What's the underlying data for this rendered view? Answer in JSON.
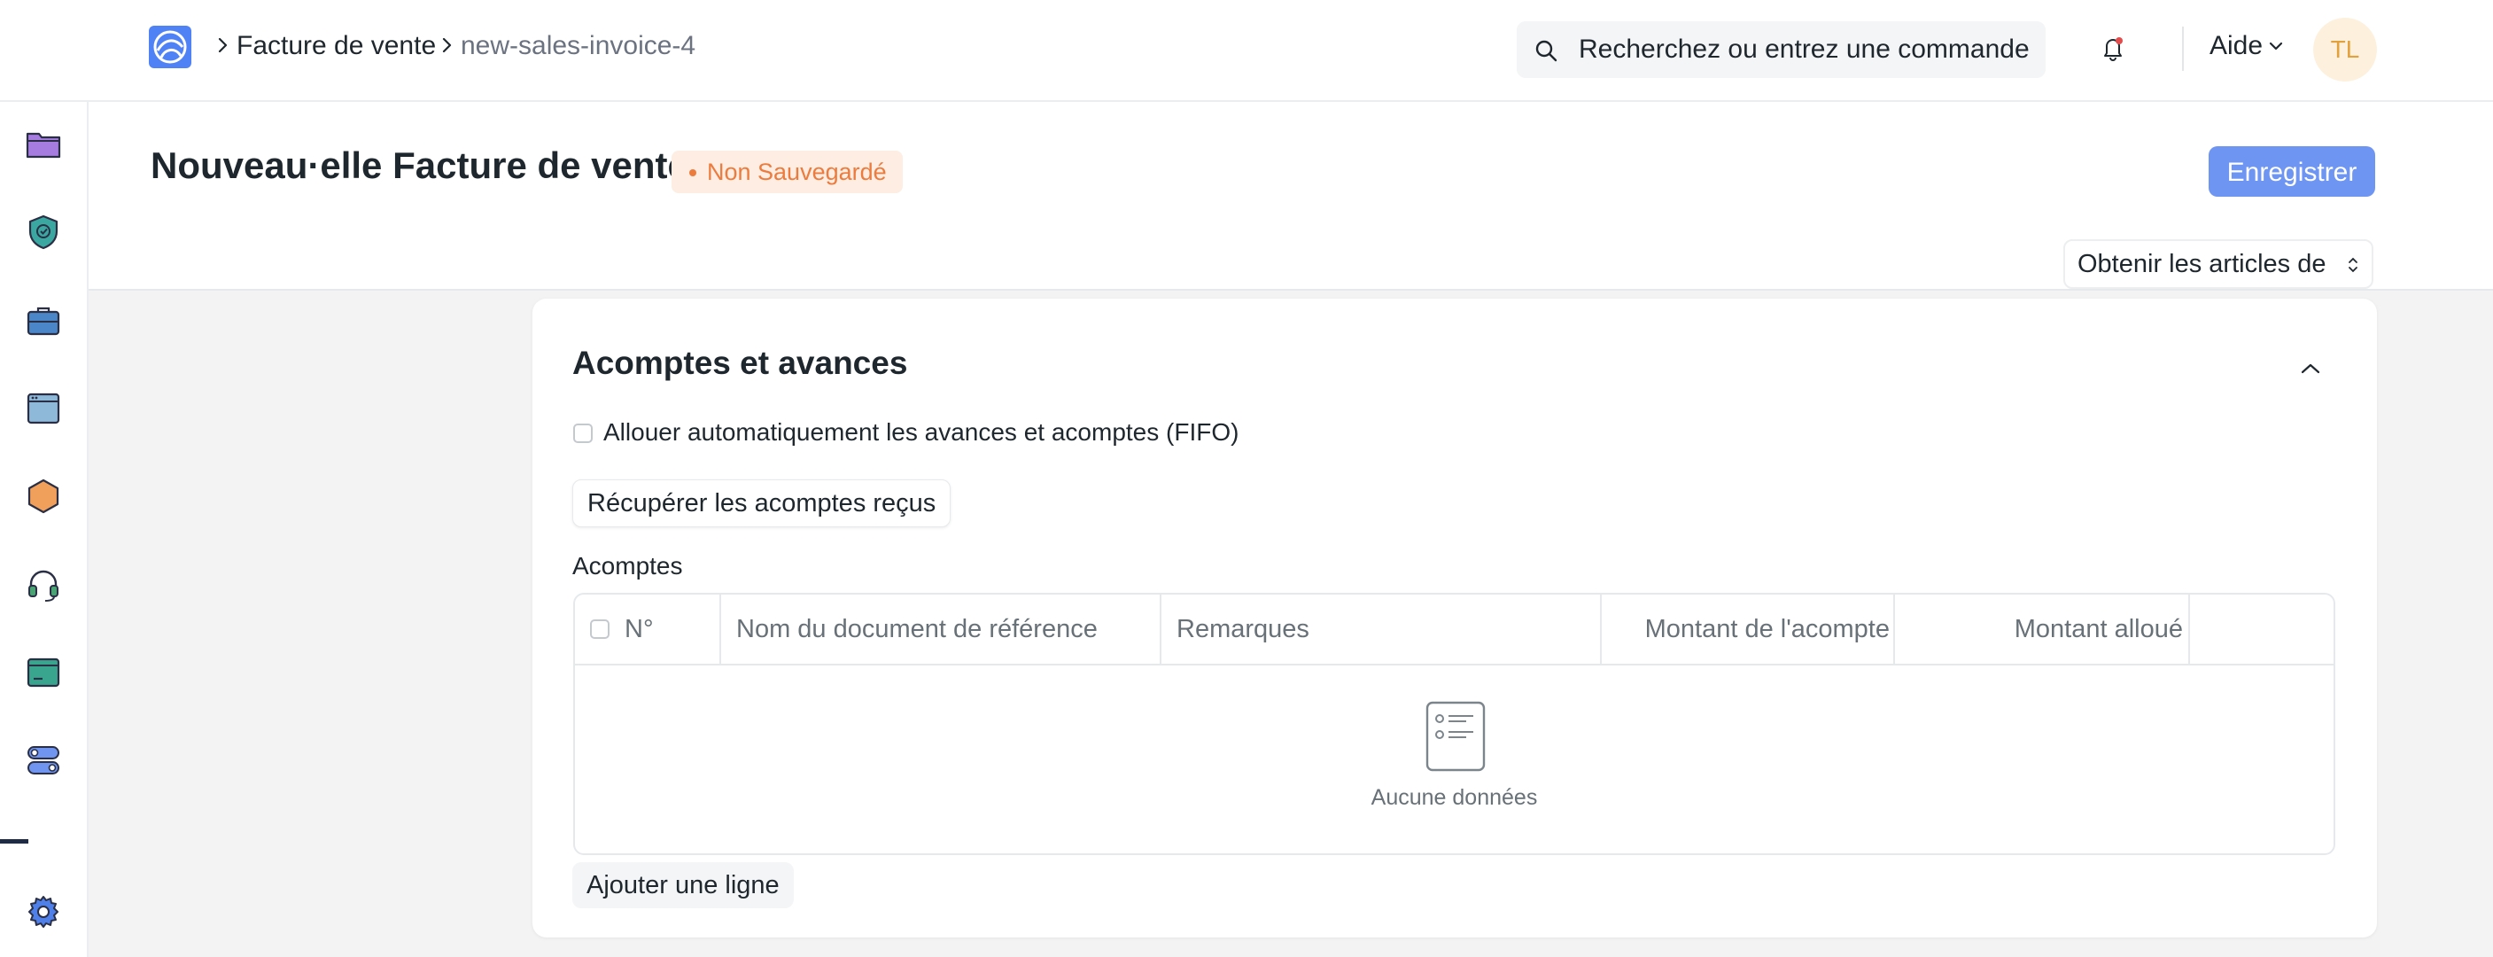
{
  "navbar": {
    "breadcrumbs": [
      "Facture de vente",
      "new-sales-invoice-4"
    ],
    "search_placeholder": "Recherchez ou entrez une commande",
    "help_label": "Aide",
    "user_initials": "TL"
  },
  "sidebar": {
    "icons": [
      "folder-icon",
      "shield-check-icon",
      "briefcase-icon",
      "window-icon",
      "hexagon-icon",
      "headset-icon",
      "terminal-icon",
      "toggle-icon",
      "gear-icon"
    ]
  },
  "page": {
    "title": "Nouveau·elle Facture de vente",
    "status": "Non Sauvegardé",
    "save_label": "Enregistrer",
    "get_items_label": "Obtenir les articles de"
  },
  "section": {
    "title": "Acomptes et avances",
    "fifo_label": "Allouer automatiquement les avances et acomptes (FIFO)",
    "fetch_label": "Récupérer les acomptes reçus",
    "table_label": "Acomptes",
    "columns": [
      "N°",
      "Nom du document de référence",
      "Remarques",
      "Montant de l'acompte",
      "Montant alloué"
    ],
    "empty_text": "Aucune données",
    "add_row_label": "Ajouter une ligne"
  },
  "colors": {
    "accent": "#6e95f2",
    "warning": "#ec7c3e",
    "warning_bg": "#fdede3"
  }
}
